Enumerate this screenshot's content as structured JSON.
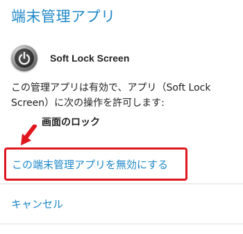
{
  "header": {
    "title": "端末管理アプリ"
  },
  "app": {
    "name": "Soft Lock Screen",
    "icon": "power-icon"
  },
  "description": "この管理アプリは有効で、アプリ（Soft Lock Screen）に次の操作を許可します:",
  "policies": [
    "画面のロック"
  ],
  "actions": {
    "deactivate_label": "この端末管理アプリを無効にする",
    "cancel_label": "キャンセル"
  },
  "colors": {
    "accent": "#1e88c8",
    "highlight": "#e0161e"
  }
}
